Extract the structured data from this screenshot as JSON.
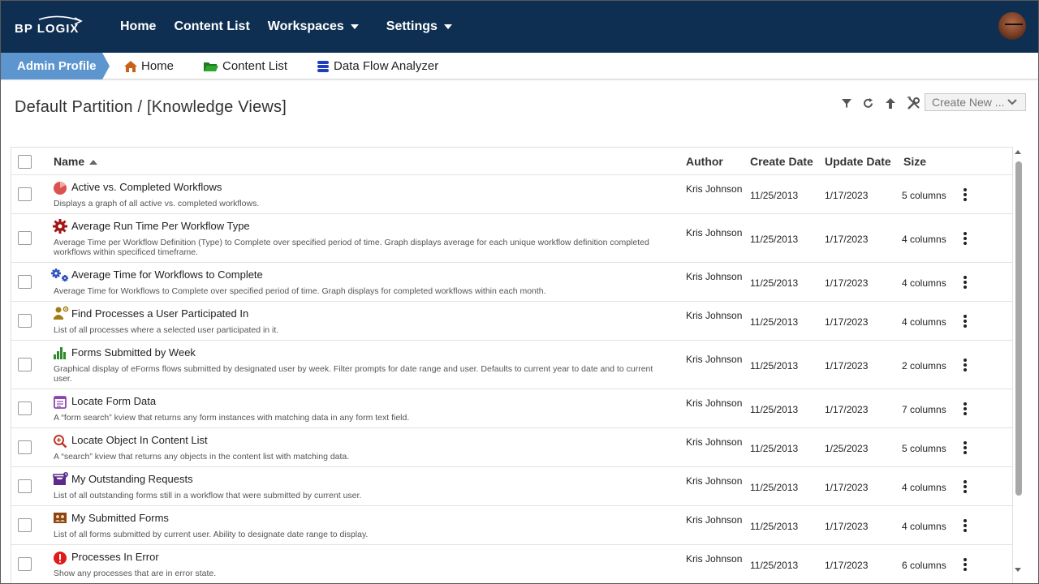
{
  "brand": {
    "logo_text": "BP LOGIX"
  },
  "topnav": {
    "items": [
      {
        "label": "Home"
      },
      {
        "label": "Content List"
      },
      {
        "label": "Workspaces",
        "has_caret": true
      },
      {
        "label": "Settings",
        "has_caret": true
      }
    ]
  },
  "breadcrumb": {
    "profile_label": "Admin Profile",
    "items": [
      {
        "label": "Home",
        "icon": "home-icon"
      },
      {
        "label": "Content List",
        "icon": "folder-icon"
      },
      {
        "label": "Data Flow Analyzer",
        "icon": "database-icon"
      }
    ]
  },
  "page": {
    "title": "Default Partition / [Knowledge Views]",
    "toolbar": {
      "icons": [
        "filter-icon",
        "refresh-icon",
        "upload-icon",
        "tools-icon"
      ],
      "create_new_label": "Create New ..."
    }
  },
  "table": {
    "columns": {
      "name": "Name",
      "author": "Author",
      "create_date": "Create Date",
      "update_date": "Update Date",
      "size": "Size"
    },
    "sort": {
      "column": "name",
      "direction": "ascending"
    },
    "rows": [
      {
        "icon": "pie-chart-icon",
        "icon_color": "#d9534f",
        "title": "Active vs. Completed Workflows",
        "description": "Displays a graph of all active vs. completed workflows.",
        "author": "Kris Johnson",
        "create_date": "11/25/2013",
        "update_date": "1/17/2023",
        "size": "5 columns"
      },
      {
        "icon": "gear-icon",
        "icon_color": "#a31515",
        "title": "Average Run Time Per Workflow Type",
        "description": "Average Time per Workflow Definition (Type) to Complete over specified period of time. Graph displays average for each unique workflow definition completed workflows within specificed timeframe.",
        "author": "Kris Johnson",
        "create_date": "11/25/2013",
        "update_date": "1/17/2023",
        "size": "4 columns"
      },
      {
        "icon": "gears-icon",
        "icon_color": "#2e4fbf",
        "title": "Average Time for Workflows to Complete",
        "description": "Average Time for Workflows to Complete over specified period of time. Graph displays for completed workflows within each month.",
        "author": "Kris Johnson",
        "create_date": "11/25/2013",
        "update_date": "1/17/2023",
        "size": "4 columns"
      },
      {
        "icon": "user-process-icon",
        "icon_color": "#a27c12",
        "title": "Find Processes a User Participated In",
        "description": "List of all processes where a selected user participated in it.",
        "author": "Kris Johnson",
        "create_date": "11/25/2013",
        "update_date": "1/17/2023",
        "size": "4 columns"
      },
      {
        "icon": "bar-chart-icon",
        "icon_color": "#2e8b2e",
        "title": "Forms Submitted by Week",
        "description": "Graphical display of eForms flows submitted by designated user by week. Filter prompts for date range and user. Defaults to current year to date and to current user.",
        "author": "Kris Johnson",
        "create_date": "11/25/2013",
        "update_date": "1/17/2023",
        "size": "2 columns"
      },
      {
        "icon": "form-icon",
        "icon_color": "#8e44ad",
        "title": "Locate Form Data",
        "description": "A “form search” kview that returns any form instances with matching data in any form text field.",
        "author": "Kris Johnson",
        "create_date": "11/25/2013",
        "update_date": "1/17/2023",
        "size": "7 columns"
      },
      {
        "icon": "search-icon",
        "icon_color": "#c0392b",
        "title": "Locate Object In Content List",
        "description": "A “search” kview that returns any objects in the content list with matching data.",
        "author": "Kris Johnson",
        "create_date": "11/25/2013",
        "update_date": "1/25/2023",
        "size": "5 columns"
      },
      {
        "icon": "inbox-icon",
        "icon_color": "#5b2a8a",
        "title": "My Outstanding Requests",
        "description": "List of all outstanding forms still in a workflow that were submitted by current user.",
        "author": "Kris Johnson",
        "create_date": "11/25/2013",
        "update_date": "1/17/2023",
        "size": "4 columns"
      },
      {
        "icon": "submitted-forms-icon",
        "icon_color": "#8b4513",
        "title": "My Submitted Forms",
        "description": "List of all forms submitted by current user. Ability to designate date range to display.",
        "author": "Kris Johnson",
        "create_date": "11/25/2013",
        "update_date": "1/17/2023",
        "size": "4 columns"
      },
      {
        "icon": "error-icon",
        "icon_color": "#e01919",
        "title": "Processes In Error",
        "description": "Show any processes that are in error state.",
        "author": "Kris Johnson",
        "create_date": "11/25/2013",
        "update_date": "1/17/2023",
        "size": "6 columns"
      }
    ]
  },
  "colors": {
    "topnav_bg": "#0e2f52",
    "profile_tab_bg": "#5d96cf"
  }
}
